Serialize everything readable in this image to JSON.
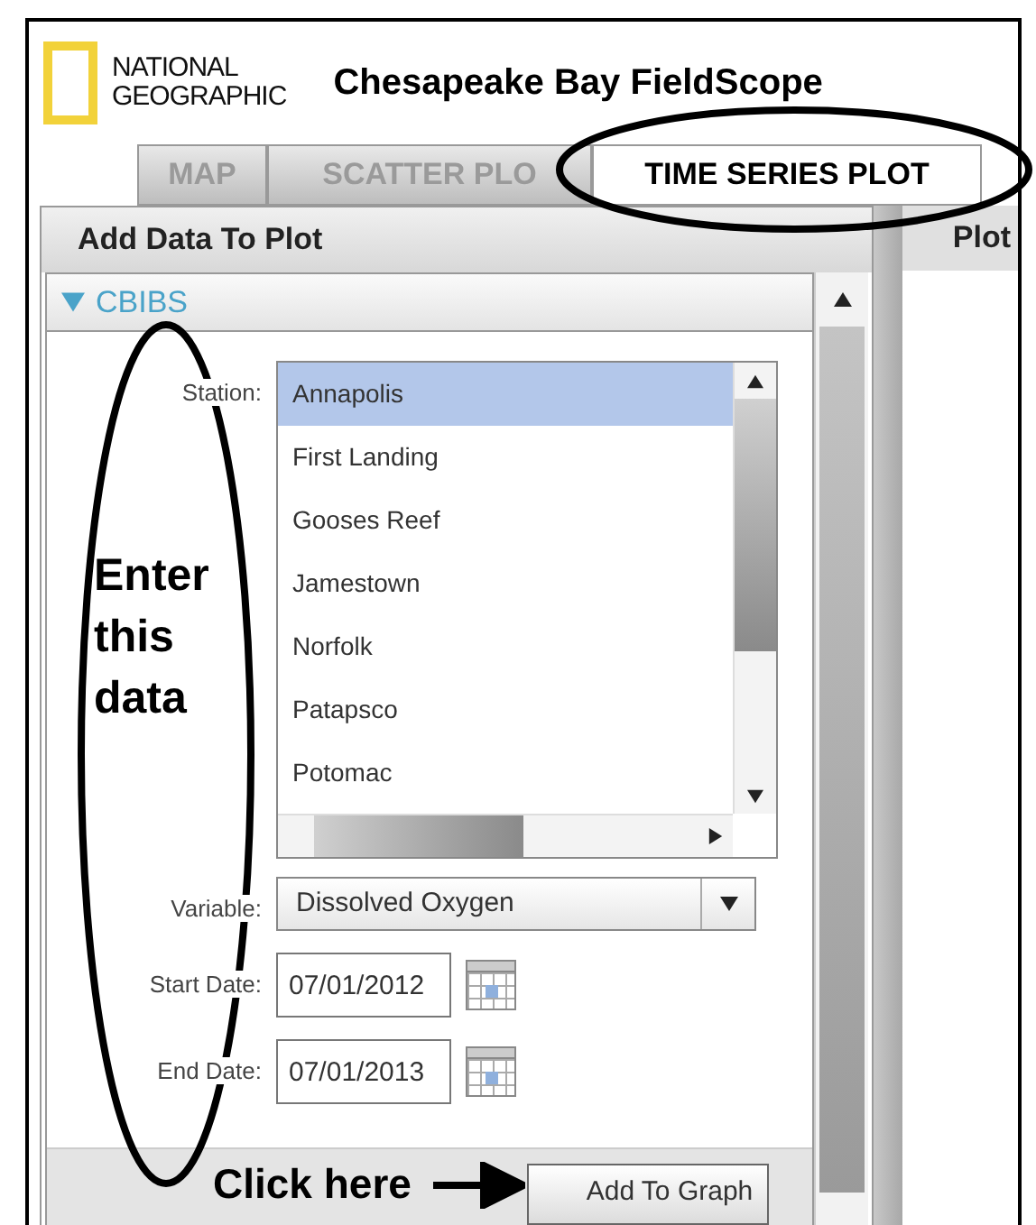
{
  "header": {
    "brand": [
      "NATIONAL",
      "GEOGRAPHIC"
    ],
    "title": "Chesapeake Bay FieldScope"
  },
  "tabs": [
    {
      "label": "MAP",
      "selected": false
    },
    {
      "label": "SCATTER PLO",
      "selected": false
    },
    {
      "label": "TIME SERIES PLOT",
      "selected": true
    }
  ],
  "panel": {
    "title": "Add Data To Plot",
    "side_title": "Plot"
  },
  "section": {
    "title": "CBIBS",
    "expanded": true
  },
  "form": {
    "station_label": "Station:",
    "stations": [
      {
        "label": "Annapolis",
        "selected": true
      },
      {
        "label": "First Landing",
        "selected": false
      },
      {
        "label": "Gooses Reef",
        "selected": false
      },
      {
        "label": "Jamestown",
        "selected": false
      },
      {
        "label": "Norfolk",
        "selected": false
      },
      {
        "label": "Patapsco",
        "selected": false
      },
      {
        "label": "Potomac",
        "selected": false
      }
    ],
    "variable_label": "Variable:",
    "variable": "Dissolved Oxygen",
    "start_label": "Start Date:",
    "start_date": "07/01/2012",
    "end_label": "End Date:",
    "end_date": "07/01/2013",
    "button": "Add To Graph"
  },
  "annotations": {
    "enter_note": "Enter this data",
    "click_note": "Click here"
  }
}
